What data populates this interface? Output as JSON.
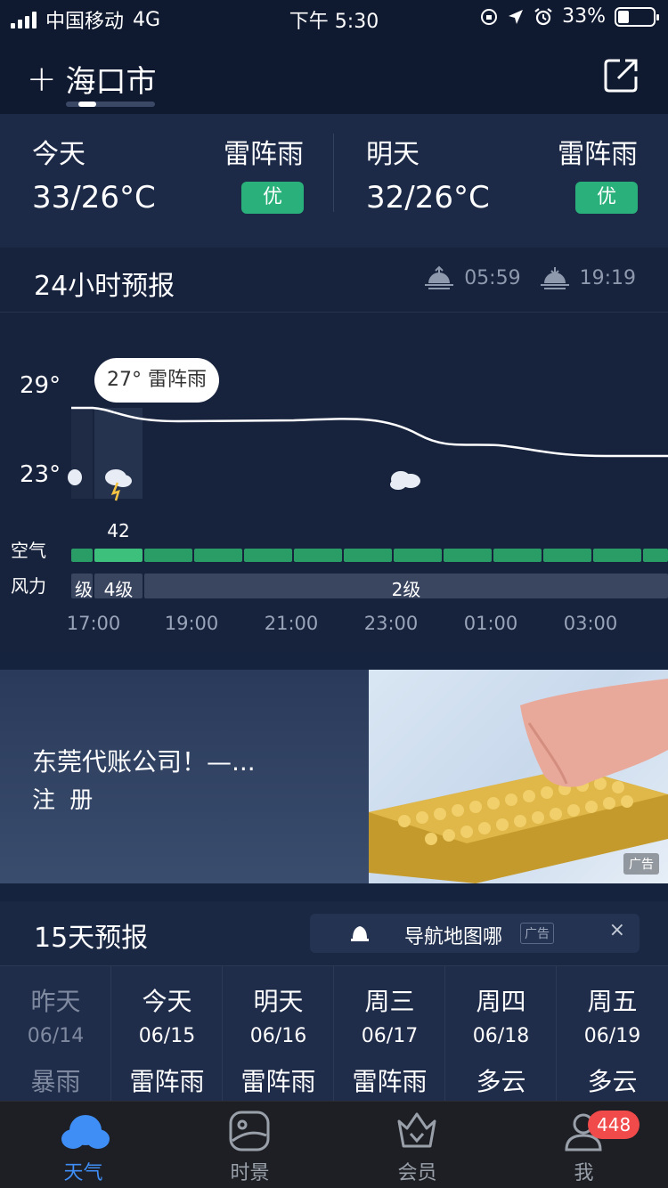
{
  "status_bar": {
    "carrier": "中国移动",
    "network": "4G",
    "time": "下午 5:30",
    "battery": "33%",
    "battery_level": 0.33
  },
  "header": {
    "city": "海口市"
  },
  "today": {
    "label": "今天",
    "condition": "雷阵雨",
    "temp": "33/26°C",
    "aqi": "优"
  },
  "tomorrow": {
    "label": "明天",
    "condition": "雷阵雨",
    "temp": "32/26°C",
    "aqi": "优"
  },
  "forecast24": {
    "title": "24小时预报",
    "sunrise": "05:59",
    "sunset": "19:19",
    "y_high": "29°",
    "y_low": "23°",
    "tooltip": "27° 雷阵雨",
    "air_label": "空气",
    "wind_label": "风力",
    "air_value": "42",
    "wind_prev": "级",
    "wind_now": "4级",
    "wind_rest": "2级",
    "hours": [
      "17:00",
      "19:00",
      "21:00",
      "23:00",
      "01:00",
      "03:00"
    ],
    "colors": {
      "aqi_good": "#2a9d67",
      "aqi_current": "#3cc07c"
    }
  },
  "ad": {
    "title": "东莞代账公司！—...",
    "subtitle": "注 册",
    "tag": "广告"
  },
  "forecast15": {
    "title": "15天预报",
    "nav_ad_text": "导航地图哪",
    "nav_ad_tag": "广告",
    "close": "×",
    "days": [
      {
        "name": "昨天",
        "date": "06/14",
        "cond": "暴雨"
      },
      {
        "name": "今天",
        "date": "06/15",
        "cond": "雷阵雨"
      },
      {
        "name": "明天",
        "date": "06/16",
        "cond": "雷阵雨"
      },
      {
        "name": "周三",
        "date": "06/17",
        "cond": "雷阵雨"
      },
      {
        "name": "周四",
        "date": "06/18",
        "cond": "多云"
      },
      {
        "name": "周五",
        "date": "06/19",
        "cond": "多云"
      }
    ]
  },
  "tabbar": {
    "weather": "天气",
    "scene": "时景",
    "member": "会员",
    "me": "我",
    "me_badge": "448"
  }
}
